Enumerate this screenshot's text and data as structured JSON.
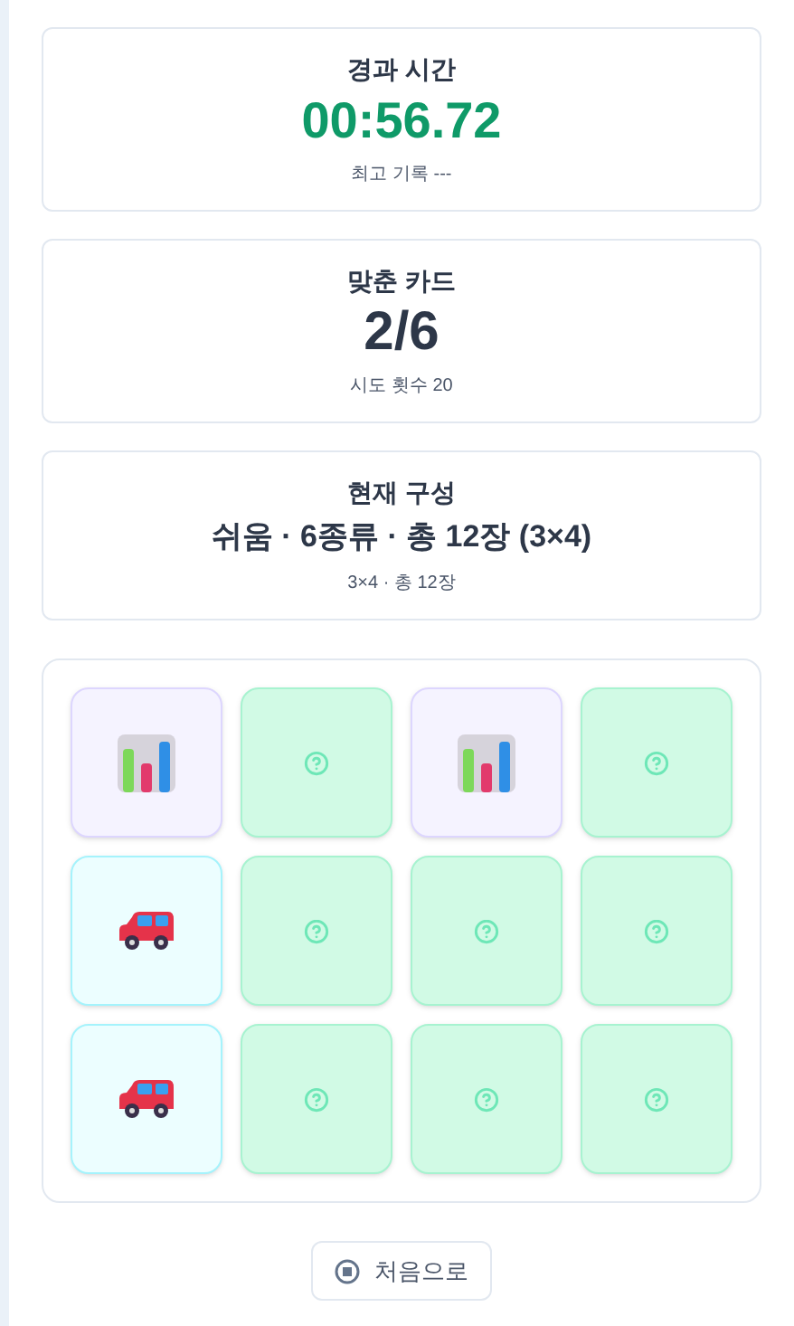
{
  "stats": [
    {
      "label": "경과 시간",
      "value": "00:56.72",
      "kind": "timer",
      "note": "최고 기록 ---"
    },
    {
      "label": "맞춘 카드",
      "value": "2/6",
      "kind": "score",
      "note": "시도 횟수 20"
    },
    {
      "label": "현재 구성",
      "value": "쉬움 · 6종류 · 총 12장 (3×4)",
      "kind": "config",
      "note": "3×4 · 총 12장"
    }
  ],
  "cards": [
    {
      "kind": "chart"
    },
    {
      "kind": "hidden"
    },
    {
      "kind": "chart"
    },
    {
      "kind": "hidden"
    },
    {
      "kind": "car"
    },
    {
      "kind": "hidden"
    },
    {
      "kind": "hidden"
    },
    {
      "kind": "hidden"
    },
    {
      "kind": "car"
    },
    {
      "kind": "hidden"
    },
    {
      "kind": "hidden"
    },
    {
      "kind": "hidden"
    }
  ],
  "restart_button": "처음으로"
}
